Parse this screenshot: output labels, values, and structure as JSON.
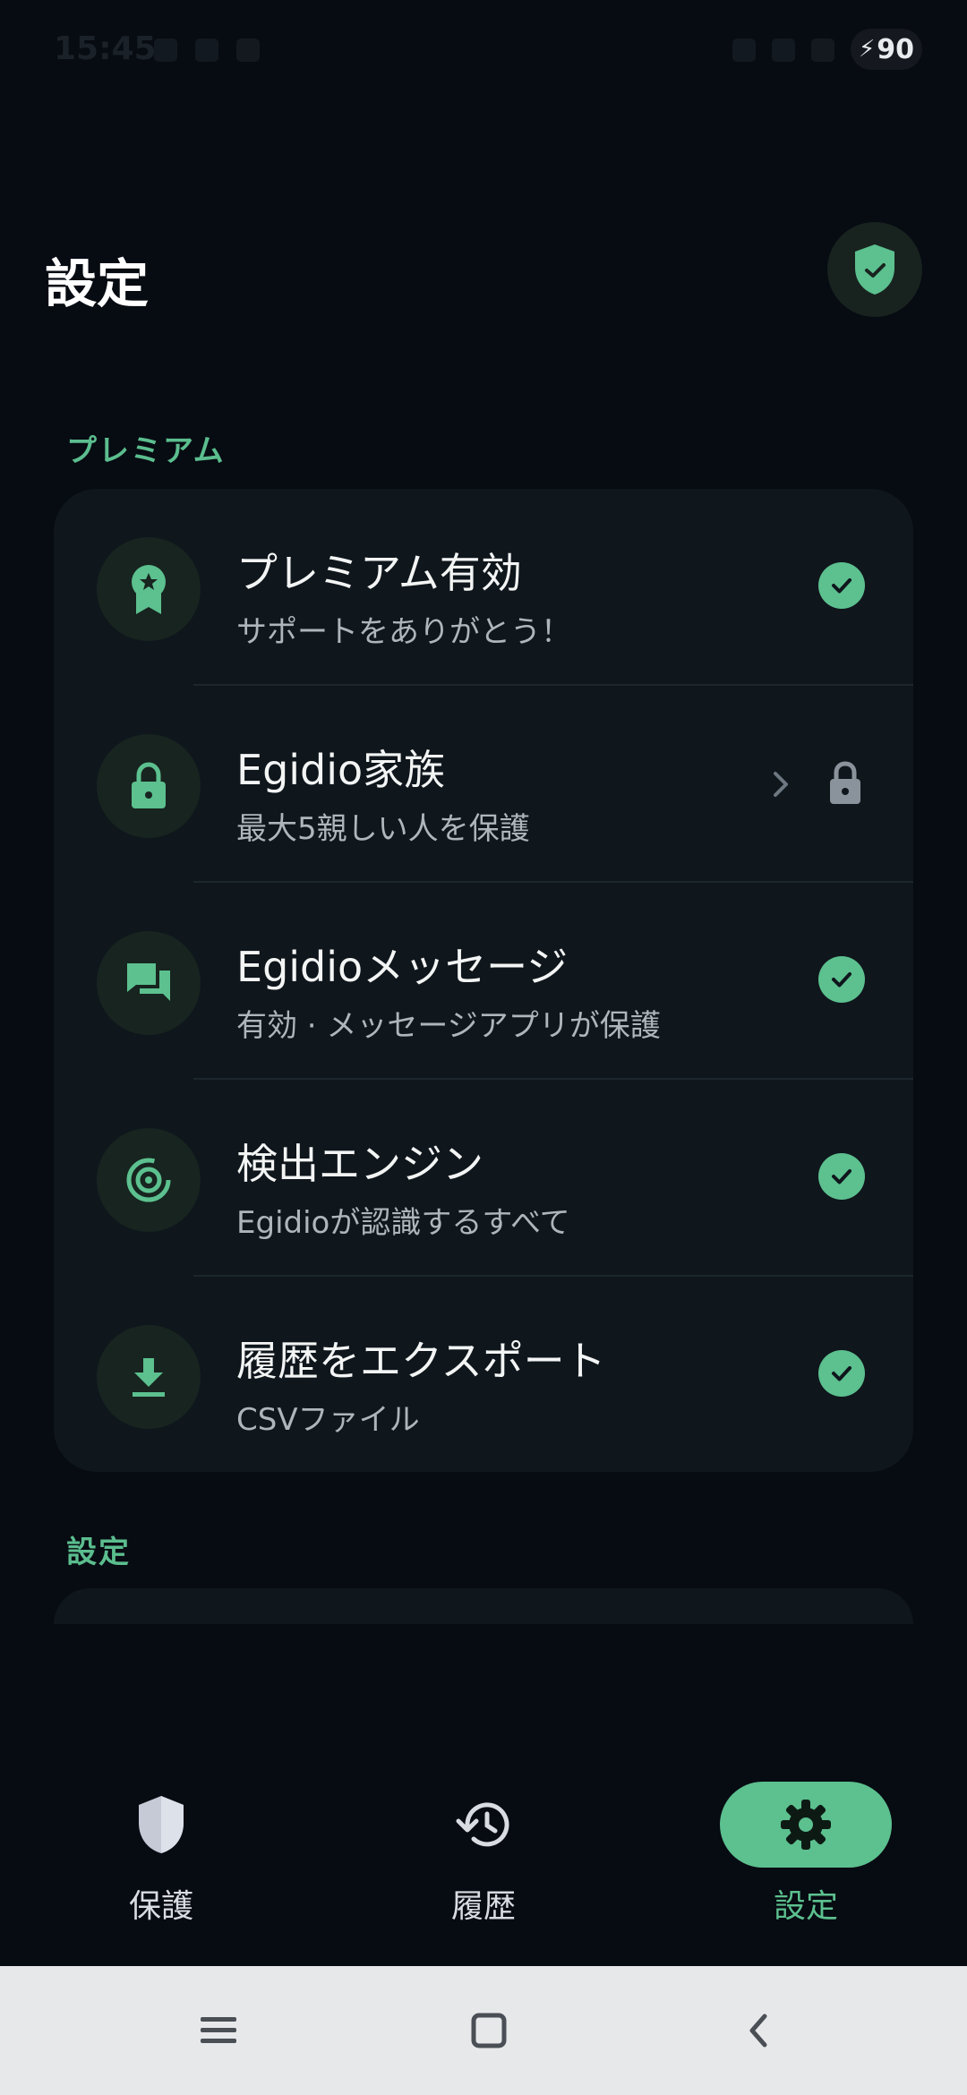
{
  "status_bar": {
    "time": "15:45",
    "battery": "90"
  },
  "header": {
    "title": "設定"
  },
  "sections": {
    "premium_label": "プレミアム",
    "settings_label": "設定"
  },
  "premium_items": [
    {
      "title": "プレミアム有効",
      "subtitle": "サポートをありがとう！",
      "icon": "medal-star-icon",
      "status": "check"
    },
    {
      "title": "Egidio家族",
      "subtitle": "最大5親しい人を保護",
      "icon": "lock-icon",
      "status": "locked"
    },
    {
      "title": "Egidioメッセージ",
      "subtitle": "有効 · メッセージアプリが保護",
      "icon": "chat-bubbles-icon",
      "status": "check"
    },
    {
      "title": "検出エンジン",
      "subtitle": "Egidioが認識するすべて",
      "icon": "radar-icon",
      "status": "check"
    },
    {
      "title": "履歴をエクスポート",
      "subtitle": "CSVファイル",
      "icon": "download-icon",
      "status": "check"
    }
  ],
  "bottom_nav": [
    {
      "label": "保護",
      "icon": "shield-icon",
      "active": false
    },
    {
      "label": "履歴",
      "icon": "history-icon",
      "active": false
    },
    {
      "label": "設定",
      "icon": "gear-icon",
      "active": true
    }
  ],
  "colors": {
    "accent": "#5cc08f",
    "background": "#070b12",
    "card": "#0f161c"
  }
}
